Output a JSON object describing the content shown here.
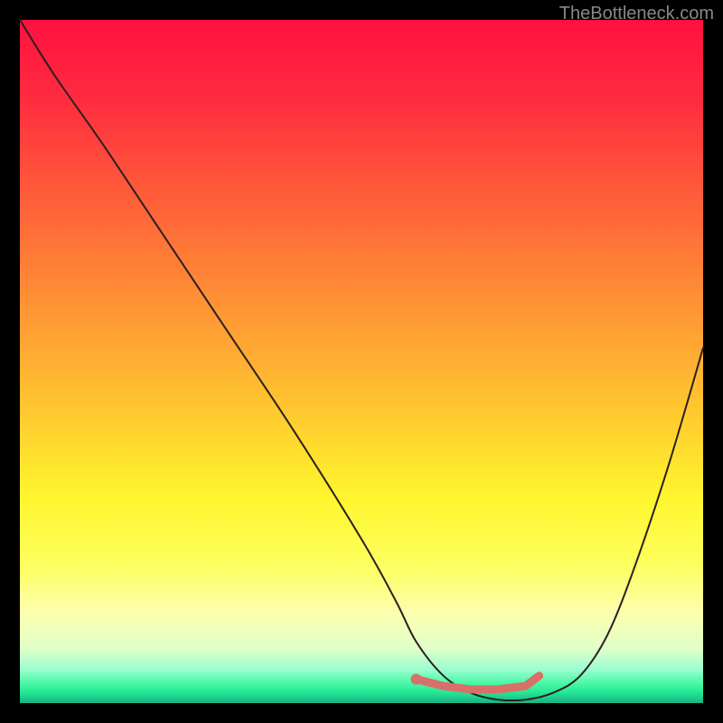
{
  "watermark": "TheBottleneck.com",
  "colors": {
    "curve_stroke": "#2a2020",
    "marker_stroke": "#d86f68",
    "marker_fill": "#d86f68"
  },
  "chart_data": {
    "type": "line",
    "title": "",
    "xlabel": "",
    "ylabel": "",
    "xlim": [
      0,
      100
    ],
    "ylim": [
      0,
      100
    ],
    "series": [
      {
        "name": "bottleneck-curve",
        "x": [
          0,
          5,
          12,
          20,
          30,
          40,
          50,
          55,
          58,
          62,
          66,
          70,
          74,
          78,
          82,
          86,
          90,
          95,
          100
        ],
        "y": [
          100,
          92,
          82,
          70,
          55,
          40,
          24,
          15,
          9,
          4,
          1.5,
          0.5,
          0.5,
          1.5,
          4,
          10,
          20,
          35,
          52
        ]
      }
    ],
    "markers": {
      "name": "optimal-range",
      "x": [
        58,
        62,
        66,
        70,
        74,
        76
      ],
      "y": [
        3.5,
        2.5,
        2,
        2,
        2.5,
        4
      ]
    }
  }
}
